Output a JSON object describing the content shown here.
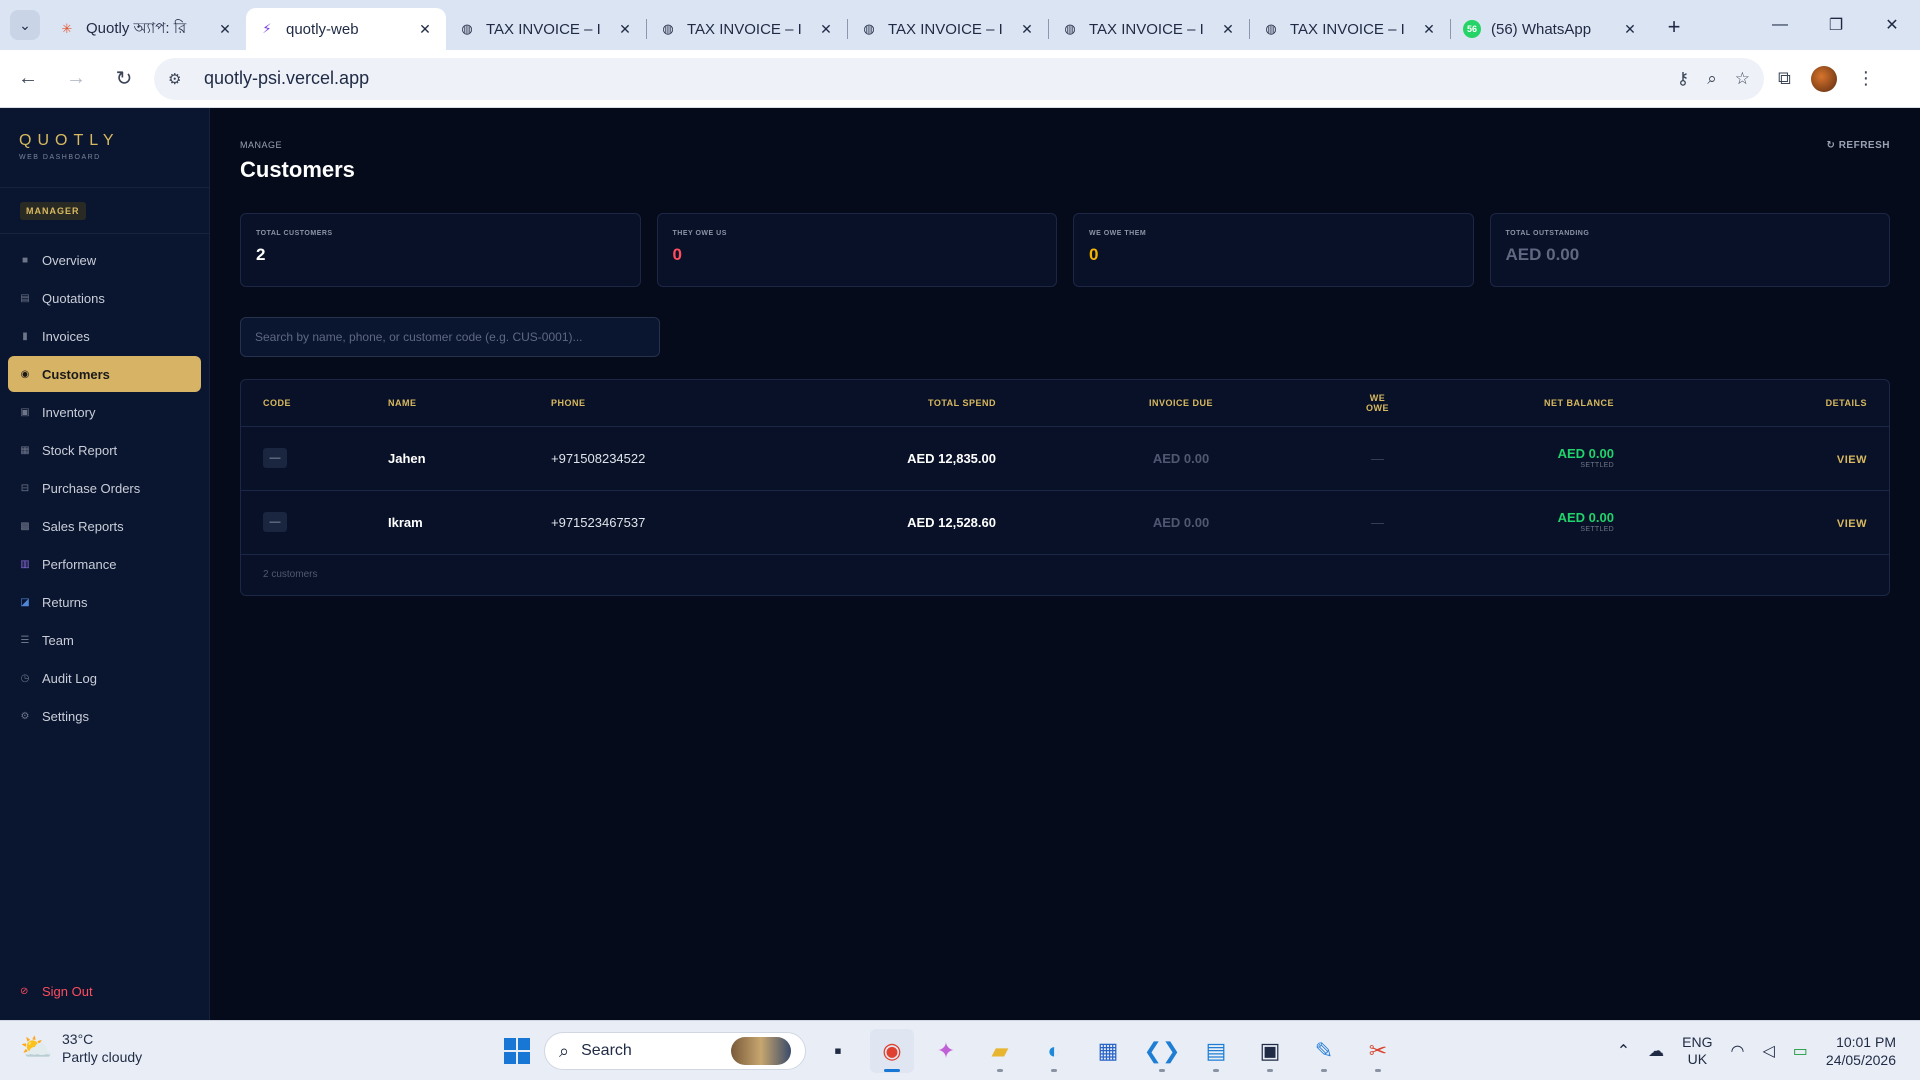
{
  "browser": {
    "tabs": [
      {
        "title": "Quotly অ্যাপ: রি",
        "icon": "asterisk-icon",
        "active": false
      },
      {
        "title": "quotly-web",
        "icon": "bolt-icon",
        "active": true
      },
      {
        "title": "TAX INVOICE – I",
        "icon": "globe-icon",
        "active": false
      },
      {
        "title": "TAX INVOICE – I",
        "icon": "globe-icon",
        "active": false
      },
      {
        "title": "TAX INVOICE – I",
        "icon": "globe-icon",
        "active": false
      },
      {
        "title": "TAX INVOICE – I",
        "icon": "globe-icon",
        "active": false
      },
      {
        "title": "TAX INVOICE – I",
        "icon": "globe-icon",
        "active": false
      },
      {
        "title": "(56) WhatsApp",
        "icon": "whatsapp-icon",
        "badge": "56",
        "active": false
      }
    ],
    "url": "quotly-psi.vercel.app"
  },
  "sidebar": {
    "brand": "QUOTLY",
    "brand_sub": "WEB DASHBOARD",
    "role": "MANAGER",
    "items": [
      {
        "label": "Overview",
        "icon": "square-icon"
      },
      {
        "label": "Quotations",
        "icon": "document-icon"
      },
      {
        "label": "Invoices",
        "icon": "invoice-icon"
      },
      {
        "label": "Customers",
        "icon": "user-circle-icon",
        "active": true
      },
      {
        "label": "Inventory",
        "icon": "box-icon"
      },
      {
        "label": "Stock Report",
        "icon": "report-icon"
      },
      {
        "label": "Purchase Orders",
        "icon": "cart-icon"
      },
      {
        "label": "Sales Reports",
        "icon": "grid-icon"
      },
      {
        "label": "Performance",
        "icon": "bar-chart-icon"
      },
      {
        "label": "Returns",
        "icon": "return-icon"
      },
      {
        "label": "Team",
        "icon": "list-icon"
      },
      {
        "label": "Audit Log",
        "icon": "clock-icon"
      },
      {
        "label": "Settings",
        "icon": "gear-icon"
      }
    ],
    "signout": "Sign Out"
  },
  "main": {
    "eyebrow": "MANAGE",
    "title": "Customers",
    "refresh": "↻ REFRESH",
    "stats": [
      {
        "label": "TOTAL CUSTOMERS",
        "value": "2",
        "color": "#ffffff"
      },
      {
        "label": "THEY OWE US",
        "value": "0",
        "color": "#ff4d5e"
      },
      {
        "label": "WE OWE THEM",
        "value": "0",
        "color": "#f5b400"
      },
      {
        "label": "TOTAL OUTSTANDING",
        "value": "AED 0.00",
        "color": "#5f6880"
      }
    ],
    "search_placeholder": "Search by name, phone, or customer code (e.g. CUS-0001)...",
    "table": {
      "headers": [
        "CODE",
        "NAME",
        "PHONE",
        "TOTAL SPEND",
        "INVOICE DUE",
        "WE OWE",
        "NET BALANCE",
        "DETAILS"
      ],
      "rows": [
        {
          "code": "—",
          "name": "Jahen",
          "phone": "+971508234522",
          "total_spend": "AED 12,835.00",
          "invoice_due": "AED 0.00",
          "we_owe": "—",
          "net_balance": "AED 0.00",
          "net_status": "SETTLED",
          "details": "VIEW"
        },
        {
          "code": "—",
          "name": "Ikram",
          "phone": "+971523467537",
          "total_spend": "AED 12,528.60",
          "invoice_due": "AED 0.00",
          "we_owe": "—",
          "net_balance": "AED 0.00",
          "net_status": "SETTLED",
          "details": "VIEW"
        }
      ],
      "footer": "2 customers"
    }
  },
  "taskbar": {
    "weather_temp": "33°C",
    "weather_desc": "Partly cloudy",
    "search_label": "Search",
    "lang_1": "ENG",
    "lang_2": "UK",
    "time": "10:01 PM",
    "date": "24/05/2026"
  }
}
